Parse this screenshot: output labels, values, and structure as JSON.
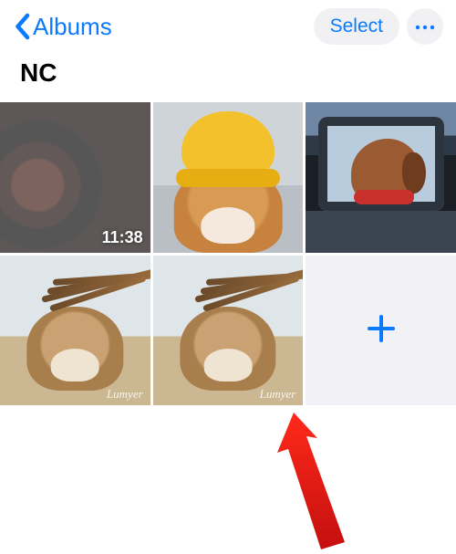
{
  "nav": {
    "back_label": "Albums",
    "select_label": "Select"
  },
  "album": {
    "title": "NC"
  },
  "tiles": [
    {
      "kind": "video",
      "duration": "11:38"
    },
    {
      "kind": "photo"
    },
    {
      "kind": "photo"
    },
    {
      "kind": "photo",
      "watermark": "Lumyer"
    },
    {
      "kind": "photo",
      "watermark": "Lumyer"
    },
    {
      "kind": "add"
    }
  ]
}
